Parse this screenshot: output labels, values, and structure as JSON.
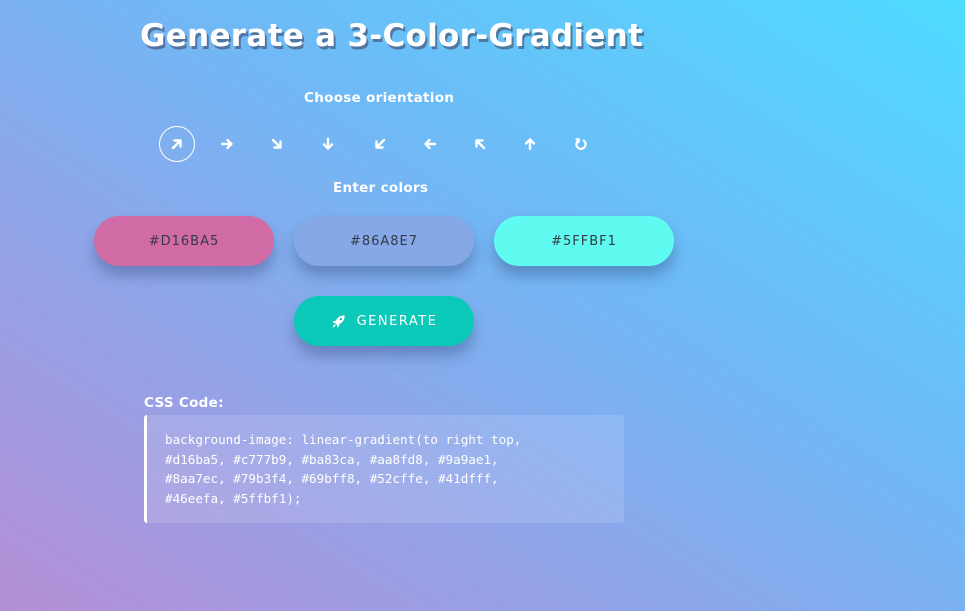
{
  "page": {
    "title": "Generate a 3-Color-Gradient"
  },
  "orientation": {
    "label": "Choose orientation",
    "options": [
      {
        "icon": "arrow-up-right-icon",
        "active": true
      },
      {
        "icon": "arrow-right-icon",
        "active": false
      },
      {
        "icon": "arrow-down-right-icon",
        "active": false
      },
      {
        "icon": "arrow-down-icon",
        "active": false
      },
      {
        "icon": "arrow-down-left-icon",
        "active": false
      },
      {
        "icon": "arrow-left-icon",
        "active": false
      },
      {
        "icon": "arrow-up-left-icon",
        "active": false
      },
      {
        "icon": "arrow-up-icon",
        "active": false
      },
      {
        "icon": "radial-rotate-icon",
        "active": false
      }
    ]
  },
  "colors": {
    "label": "Enter colors",
    "color1": {
      "value": "#D16BA5",
      "bg": "#d16ba5"
    },
    "color2": {
      "value": "#86A8E7",
      "bg": "#86a8e7"
    },
    "color3": {
      "value": "#5FFBF1",
      "bg": "#5ffbf1"
    }
  },
  "generate": {
    "label": "GENERATE",
    "icon": "rocket-icon",
    "bg": "#0ac9b8"
  },
  "css_output": {
    "label": "CSS Code:",
    "code": "background-image: linear-gradient(to right top,\n#d16ba5, #c777b9, #ba83ca, #aa8fd8, #9a9ae1,\n#8aa7ec, #79b3f4, #69bff8, #52cffe, #41dfff,\n#46eefa, #5ffbf1);"
  }
}
